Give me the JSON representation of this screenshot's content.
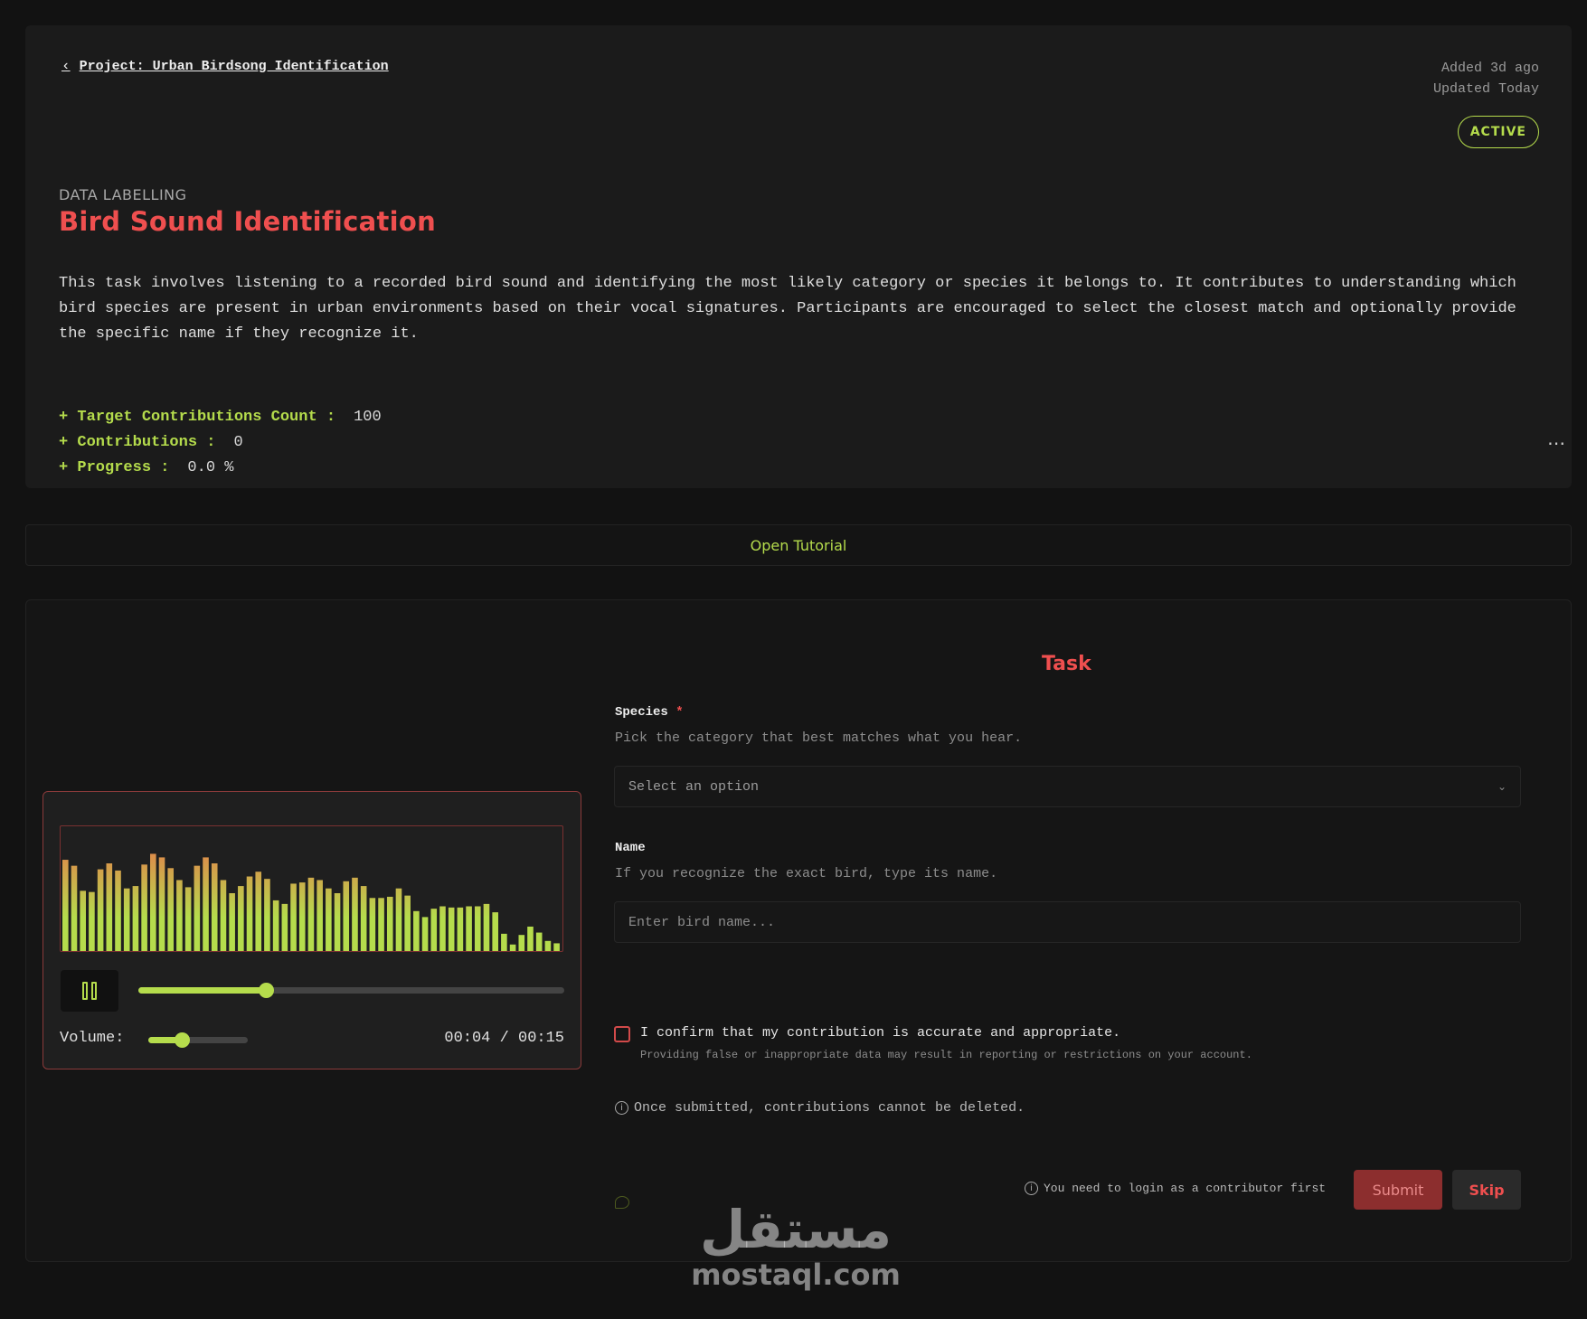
{
  "header": {
    "back_label": "Project: Urban Birdsong Identification",
    "added": "Added 3d ago",
    "updated": "Updated Today",
    "status": "ACTIVE"
  },
  "task_info": {
    "category": "DATA LABELLING",
    "title": "Bird Sound Identification",
    "description": "This task involves listening to a recorded bird sound and identifying the most likely category or species it belongs to. It contributes to understanding which bird species are present in urban environments based on their vocal signatures. Participants are encouraged to select the closest match and optionally provide the specific name if they recognize it.",
    "stats": [
      {
        "label": "+ Target Contributions Count :",
        "value": "100"
      },
      {
        "label": "+ Contributions :",
        "value": "0"
      },
      {
        "label": "+ Progress :",
        "value": "0.0 %"
      }
    ],
    "more_icon": "ellipsis-icon"
  },
  "tutorial": {
    "label": "Open Tutorial"
  },
  "player": {
    "waveform_levels": [
      0.78,
      0.73,
      0.52,
      0.51,
      0.7,
      0.75,
      0.69,
      0.54,
      0.56,
      0.74,
      0.83,
      0.8,
      0.71,
      0.61,
      0.55,
      0.73,
      0.8,
      0.75,
      0.61,
      0.5,
      0.56,
      0.64,
      0.68,
      0.62,
      0.44,
      0.41,
      0.58,
      0.59,
      0.63,
      0.61,
      0.54,
      0.5,
      0.6,
      0.63,
      0.56,
      0.46,
      0.46,
      0.47,
      0.54,
      0.48,
      0.35,
      0.3,
      0.37,
      0.39,
      0.38,
      0.38,
      0.39,
      0.39,
      0.41,
      0.34,
      0.16,
      0.07,
      0.15,
      0.22,
      0.17,
      0.1,
      0.08
    ],
    "progress": 0.3,
    "volume": 0.34,
    "volume_label": "Volume:",
    "time": "00:04 / 00:15",
    "play_icon": "pause-icon",
    "colors": {
      "bar_top": "#e8764a",
      "bar_bottom": "#b5dc4c",
      "accent": "#b5dc4c"
    }
  },
  "form": {
    "heading": "Task",
    "species_label": "Species",
    "required_mark": "*",
    "species_help": "Pick the category that best matches what you hear.",
    "species_placeholder": "Select an option",
    "name_label": "Name",
    "name_help": "If you recognize the exact bird, type its name.",
    "name_placeholder": "Enter bird name...",
    "confirm_label": "I confirm that my contribution is accurate and appropriate.",
    "confirm_sub": "Providing false or inappropriate data may result in reporting or restrictions on your account.",
    "notice": "Once submitted, contributions cannot be deleted.",
    "login_notice": "You need to login as a contributor first",
    "submit_label": "Submit",
    "skip_label": "Skip"
  },
  "watermark": {
    "arabic": "مستقل",
    "latin": "mostaql.com"
  },
  "colors": {
    "accent": "#b5dc4c",
    "brand_red": "#ef4f4f",
    "background": "#121212"
  }
}
